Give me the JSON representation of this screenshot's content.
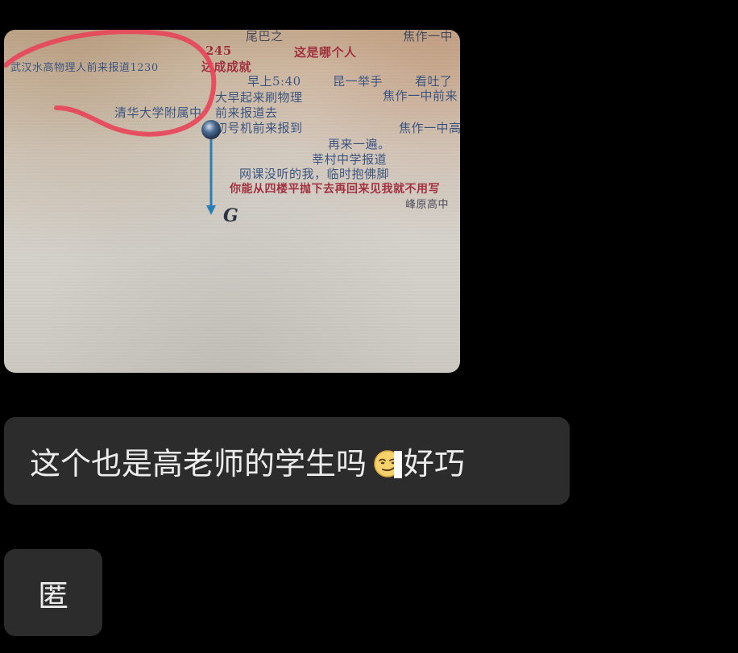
{
  "chat": {
    "messages": [
      {
        "type": "image",
        "photo": {
          "danmaku": [
            "尾巴之",
            "焦作一中",
            "武汉水高物理人前来报道1230",
            "这是哪个人",
            "245",
            "达成成就",
            "早上5:40",
            "昆一举手",
            "看吐了",
            "大早起来刷物理",
            "焦作一中前来",
            "清华大学附属中",
            "前来报道去",
            "初号机前来报到",
            "焦作一中高",
            "再来一遍。",
            "莘村中学报道",
            "网课没听的我，临时抱佛脚",
            "你能从四楼平抛下去再回来见我就不用写",
            "峰原高中"
          ],
          "diagram_label": "G",
          "colors": {
            "circle_annotation": "#e8475a",
            "vector": "#2a7fb5"
          }
        }
      },
      {
        "type": "text",
        "text_before": "这个也是高老师的学生吗",
        "emoji": "smirk-face-emoji",
        "text_after": "好巧"
      },
      {
        "type": "text",
        "text": "匿"
      }
    ]
  },
  "colors": {
    "background": "#000000",
    "bubble": "#2c2c2c",
    "text": "#ededed"
  }
}
